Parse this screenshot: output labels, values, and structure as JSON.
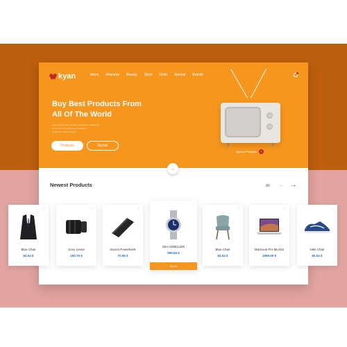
{
  "brand": {
    "name": "kyan"
  },
  "nav": [
    "Mens",
    "Womens",
    "Beauty",
    "Sport",
    "Child",
    "Special",
    "Brands"
  ],
  "hero": {
    "headline_line1": "Buy Best Products From",
    "headline_line2": "All Of The World",
    "subtext_line1": "Lorem ipsum dolor sit amet, consectetur adipiscing",
    "subtext_line2": "elit sed do eiusmod tempor incididunt",
    "subtext_line3": "ut labore et dolore magna",
    "primary_button": "Products",
    "secondary_button": "Nyrsar",
    "special_label": "Special Products"
  },
  "section": {
    "title": "Newest Products",
    "filter": "All"
  },
  "products": [
    {
      "name": "Blue Chair",
      "price": "84.54 $"
    },
    {
      "name": "Sony Lense",
      "price": "150.75 $"
    },
    {
      "name": "Xiaomi Powerbenk",
      "price": "70.99 $"
    },
    {
      "name": "SEA-DWELLER",
      "price": "999.66 $",
      "button": "Share"
    },
    {
      "name": "Blue Chair",
      "price": "84.54 $"
    },
    {
      "name": "Macbook Pro MLH42",
      "price": "1999.99 $"
    },
    {
      "name": "Nike Chair",
      "price": "84.54 $"
    }
  ],
  "colors": {
    "hero_orange": "#f6961d",
    "backdrop_brown": "#bc5f0f",
    "backdrop_pink": "#e2a4a0",
    "accent_red": "#c0262c",
    "price_blue": "#2b6cd4"
  }
}
